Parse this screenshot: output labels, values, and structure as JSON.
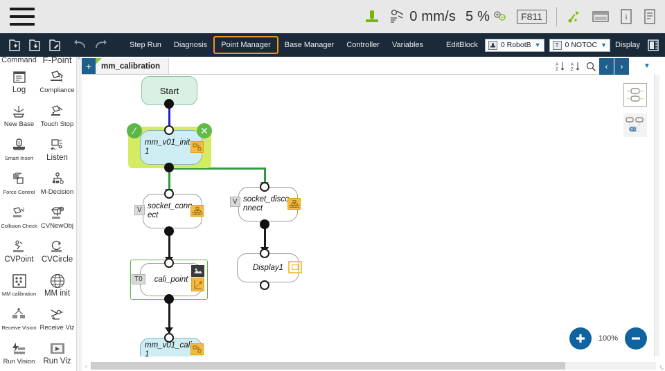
{
  "statusbar": {
    "menu_icon": "hamburger-menu-icon",
    "robot_icon": "robot-jog-icon",
    "speed_icon": "speed-icon",
    "speed_value": "0 mm/s",
    "override_value": "5 %",
    "override_icon": "zoom-adjust-icon",
    "frame_value": "F811",
    "tool_icon": "tool-icon",
    "keyboard_icon": "keyboard-icon",
    "info_icon": "info-icon",
    "log_icon": "log-icon"
  },
  "toolbar": {
    "icons": [
      {
        "name": "new-file-icon"
      },
      {
        "name": "open-file-icon"
      },
      {
        "name": "edit-file-icon"
      },
      {
        "name": "undo-icon"
      },
      {
        "name": "redo-icon"
      }
    ],
    "menu": [
      {
        "label": "Step Run",
        "active": false
      },
      {
        "label": "Diagnosis",
        "active": false
      },
      {
        "label": "Point Manager",
        "active": true
      },
      {
        "label": "Base Manager",
        "active": false
      },
      {
        "label": "Controller",
        "active": false
      },
      {
        "label": "Variables",
        "active": false
      }
    ],
    "edit_block_label": "EditBlock",
    "robot_select": {
      "badge": "▤",
      "value": "0 RobotB"
    },
    "tool_select": {
      "badge": "T",
      "value": "0 NOTOC"
    },
    "display_label": "Display",
    "panel_icon": "panel-layout-icon"
  },
  "sidebar": {
    "headers": [
      "Command",
      "F-Point"
    ],
    "items": [
      {
        "label": "Log",
        "icon": "log-document-icon",
        "size": "big"
      },
      {
        "label": "Compliance",
        "icon": "compliance-icon",
        "size": "mid"
      },
      {
        "label": "New Base",
        "icon": "new-base-icon",
        "size": "mid"
      },
      {
        "label": "Touch Stop",
        "icon": "touch-stop-icon",
        "size": "mid"
      },
      {
        "label": "Smart Insert",
        "icon": "smart-insert-icon",
        "size": "small"
      },
      {
        "label": "Listen",
        "icon": "listen-icon",
        "size": "big"
      },
      {
        "label": "Force Control",
        "icon": "force-control-icon",
        "size": "small"
      },
      {
        "label": "M-Decision",
        "icon": "m-decision-icon",
        "size": "mid"
      },
      {
        "label": "Collision Check",
        "icon": "collision-check-icon",
        "size": "small"
      },
      {
        "label": "CVNewObj",
        "icon": "cv-new-obj-icon",
        "size": "mid"
      },
      {
        "label": "CVPoint",
        "icon": "cv-point-icon",
        "size": "big"
      },
      {
        "label": "CVCircle",
        "icon": "cv-circle-icon",
        "size": "big"
      },
      {
        "label": "MM calibration",
        "icon": "mm-calibration-icon",
        "size": "small"
      },
      {
        "label": "MM init",
        "icon": "mm-init-icon",
        "size": "big"
      },
      {
        "label": "Receive Vision",
        "icon": "receive-vision-icon",
        "size": "small"
      },
      {
        "label": "Receive Viz",
        "icon": "receive-viz-icon",
        "size": "mid"
      },
      {
        "label": "Run Vision",
        "icon": "run-vision-icon",
        "size": "mid"
      },
      {
        "label": "Run Viz",
        "icon": "run-viz-icon",
        "size": "big"
      }
    ]
  },
  "tabbar": {
    "add_label": "+",
    "tabs": [
      {
        "label": "mm_calibration",
        "active": true
      }
    ],
    "tools": [
      {
        "name": "sort-az-icon"
      },
      {
        "name": "sort-za-icon"
      },
      {
        "name": "search-zoom-icon"
      }
    ],
    "prev_label": "‹",
    "next_label": "›",
    "dropdown_label": "▼"
  },
  "canvas": {
    "nodes": [
      {
        "id": "start",
        "label": "Start",
        "type": "start"
      },
      {
        "id": "mm_v01_init",
        "label": "mm_v01_init\n1",
        "type": "cyan",
        "selected": true,
        "icon": "mm-node-icon"
      },
      {
        "id": "socket_connect",
        "label": "socket_conn\nect",
        "type": "plain",
        "tag": "V",
        "icon": "tree-hierarchy-icon"
      },
      {
        "id": "socket_disconnect",
        "label": "socket_disco\nnnect",
        "type": "plain",
        "tag": "V",
        "icon": "tree-hierarchy-icon"
      },
      {
        "id": "cali_point",
        "label": "cali_point",
        "type": "plain",
        "tag": "T0",
        "highlighted": true,
        "icon": "waypoint-icon"
      },
      {
        "id": "display1",
        "label": "Display1",
        "type": "plain",
        "icon": "display-frame-icon"
      },
      {
        "id": "mm_v01_cali",
        "label": "mm_v01_cali\n1",
        "type": "cyan",
        "icon": "mm-node-icon"
      }
    ],
    "node_actions": {
      "confirm": "∕",
      "delete": "✕"
    },
    "right_panel": [
      {
        "name": "align-nodes-icon"
      },
      {
        "name": "connection-toggle-icon",
        "state": "OFF"
      }
    ],
    "zoom": {
      "in_label": "+",
      "out_label": "−",
      "level": "100%"
    }
  },
  "colors": {
    "accent_orange": "#f0941e",
    "accent_blue": "#1f5f8b",
    "node_green": "#5cb64a",
    "highlight_green": "#d5ec62",
    "node_cyan": "#cfeef4",
    "start_green": "#d9f0e3",
    "toolbar_dark": "#1b2a38"
  }
}
